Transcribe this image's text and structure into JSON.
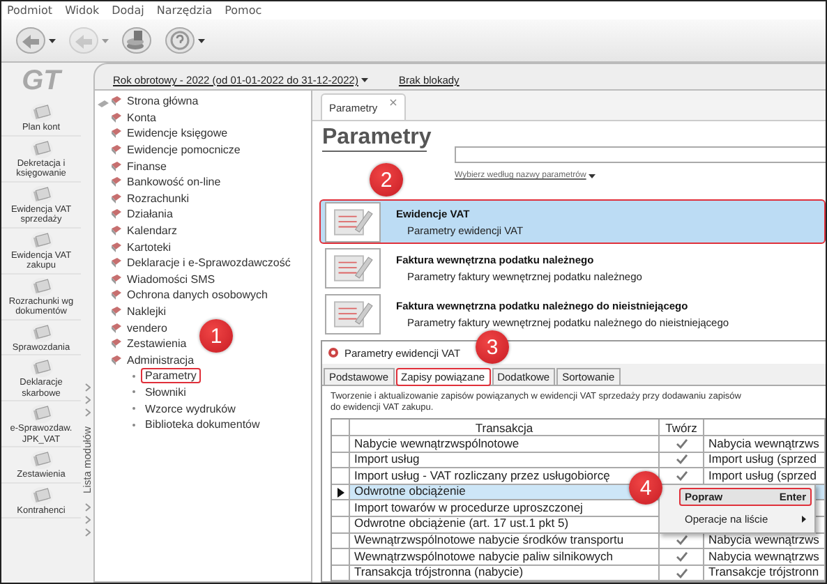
{
  "menu": [
    "Podmiot",
    "Widok",
    "Dodaj",
    "Narzędzia",
    "Pomoc"
  ],
  "toolbar": [
    {
      "kind": "arrow",
      "dropdown": true,
      "disabled": false
    },
    {
      "kind": "arrow",
      "dropdown": true,
      "disabled": true
    },
    {
      "kind": "coins",
      "dropdown": false,
      "disabled": false
    },
    {
      "kind": "help",
      "dropdown": true,
      "disabled": false
    }
  ],
  "logo": "GT",
  "modules": [
    "Plan kont",
    "Dekretacja i\nksięgowanie",
    "Ewidencja VAT\nsprzedaży",
    "Ewidencja VAT\nzakupu",
    "Rozrachunki wg\ndokumentów",
    "Sprawozdania",
    "Deklaracje\nskarbowe",
    "e-Sprawozdaw.\nJPK_VAT",
    "Zestawienia",
    "Kontrahenci"
  ],
  "module_strip_label": "Lista modułów",
  "year": "Rok obrotowy - 2022  (od 01-01-2022 do 31-12-2022)",
  "lock": "Brak blokady",
  "tree": [
    {
      "label": "Strona główna"
    },
    {
      "label": "Konta"
    },
    {
      "label": "Ewidencje księgowe"
    },
    {
      "label": "Ewidencje pomocnicze"
    },
    {
      "label": "Finanse"
    },
    {
      "label": "Bankowość on-line"
    },
    {
      "label": "Rozrachunki"
    },
    {
      "label": "Działania"
    },
    {
      "label": "Kalendarz"
    },
    {
      "label": "Kartoteki"
    },
    {
      "label": "Deklaracje i e-Sprawozdawczość"
    },
    {
      "label": "Wiadomości SMS"
    },
    {
      "label": "Ochrona danych osobowych"
    },
    {
      "label": "Naklejki"
    },
    {
      "label": "vendero"
    },
    {
      "label": "Zestawienia"
    },
    {
      "label": "Administracja",
      "children": [
        {
          "label": "Parametry",
          "highlighted": true
        },
        {
          "label": "Słowniki",
          "highlighted": false
        },
        {
          "label": "Wzorce wydruków",
          "highlighted": false
        },
        {
          "label": "Biblioteka dokumentów",
          "highlighted": false
        }
      ]
    }
  ],
  "tab": {
    "label": "Parametry",
    "close": "×"
  },
  "heading": "Parametry",
  "filter_link": "Wybierz według nazwy parametrów",
  "params": [
    {
      "title": "Ewidencje VAT",
      "subtitle": "Parametry ewidencji VAT",
      "selected": true,
      "highlighted": true
    },
    {
      "title": "Faktura wewnętrzna podatku należnego",
      "subtitle": "Parametry faktury wewnętrznej podatku należnego",
      "selected": false,
      "highlighted": false
    },
    {
      "title": "Faktura wewnętrzna podatku należnego do nieistniejącego",
      "subtitle": "Parametry faktury wewnętrznej podatku należnego do nieistniejącego",
      "selected": false,
      "highlighted": false
    }
  ],
  "dialog": {
    "title": "Parametry ewidencji VAT",
    "tabs": [
      {
        "label": "Podstawowe",
        "selected": false,
        "highlighted": false
      },
      {
        "label": "Zapisy powiązane",
        "selected": true,
        "highlighted": true
      },
      {
        "label": "Dodatkowe",
        "selected": false,
        "highlighted": false
      },
      {
        "label": "Sortowanie",
        "selected": false,
        "highlighted": false
      }
    ],
    "description": "Tworzenie i aktualizowanie zapisów powiązanych w ewidencji VAT sprzedaży przy dodawaniu zapisów\ndo ewidencji VAT zakupu.",
    "columns": [
      "Transakcja",
      "Twórz"
    ],
    "rows": [
      {
        "transakcja": "Nabycie wewnątrzwspólnotowe",
        "checked": true,
        "column_3": "Nabycia wewnątrzws",
        "selected": false
      },
      {
        "transakcja": "Import usług",
        "checked": true,
        "column_3": "Import usług (sprzed",
        "selected": false
      },
      {
        "transakcja": "Import usług - VAT rozliczany przez usługobiorcę",
        "checked": true,
        "column_3": "Import usług (sprzed",
        "selected": false
      },
      {
        "transakcja": "Odwrotne obciążenie",
        "selected": true
      },
      {
        "transakcja": "Import towarów w procedurze uproszczonej",
        "selected": false
      },
      {
        "transakcja": "Odwrotne obciążenie (art. 17 ust.1 pkt 5)",
        "selected": false
      },
      {
        "transakcja": "Wewnątrzwspólnotowe nabycie środków transportu",
        "checked": true,
        "column_3": "Nabycia wewnątrzws",
        "selected": false
      },
      {
        "transakcja": "Wewnątrzwspólnotowe nabycie paliw silnikowych",
        "checked": true,
        "column_3": "Nabycia wewnątrzws",
        "selected": false
      },
      {
        "transakcja": "Transakcja trójstronna (nabycie)",
        "checked": true,
        "column_3": "Transakcje trójstronn",
        "selected": false
      }
    ]
  },
  "context_menu": [
    {
      "label": "Popraw",
      "shortcut": "Enter",
      "highlighted": true,
      "submenu": false
    },
    {
      "label": "Operacje na liście",
      "highlighted": false,
      "submenu": true
    }
  ],
  "badges": [
    "1",
    "2",
    "3",
    "4"
  ]
}
